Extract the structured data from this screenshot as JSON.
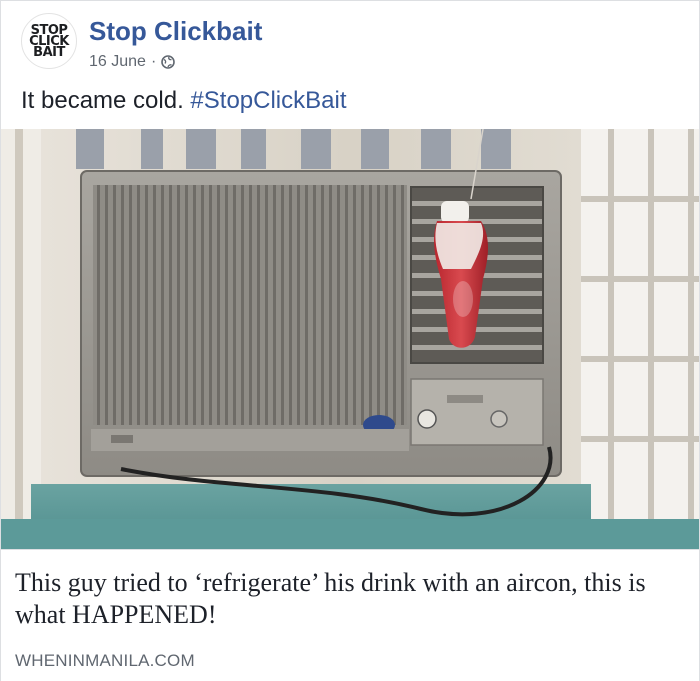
{
  "post": {
    "page_name": "Stop Clickbait",
    "avatar_lines": [
      "STOP",
      "CLICK",
      "BAIT"
    ],
    "date": "16 June",
    "separator": "·",
    "privacy_icon": "globe-icon",
    "text": "It became cold.",
    "hashtag": "#StopClickBait"
  },
  "link": {
    "title": "This guy tried to ‘refrigerate’ his drink with an aircon, this is what HAPPENED!",
    "domain": "WHENINMANILA.COM"
  },
  "colors": {
    "link_blue": "#365899",
    "meta_gray": "#606770",
    "text": "#1d2129"
  }
}
